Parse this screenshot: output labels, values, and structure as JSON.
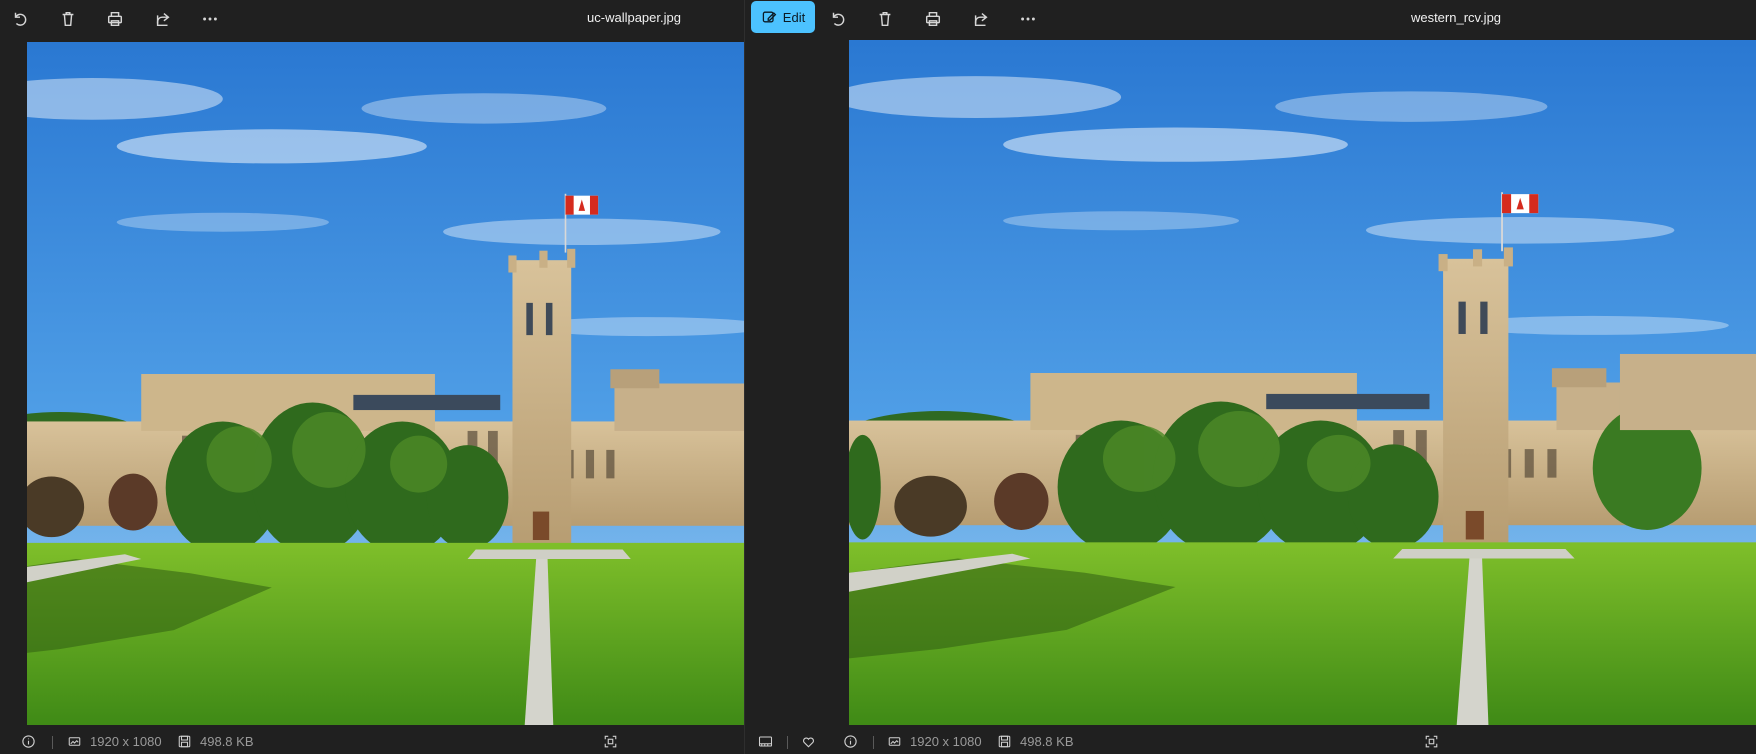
{
  "left_viewer": {
    "title": "uc-wallpaper.jpg",
    "toolbar": {
      "icons": [
        "rotate-icon",
        "delete-icon",
        "print-icon",
        "share-icon",
        "more-icon"
      ]
    },
    "status": {
      "dimensions": "1920 x 1080",
      "file_size": "498.8 KB"
    }
  },
  "right_viewer": {
    "title": "western_rcv.jpg",
    "toolbar": {
      "edit_label": "Edit",
      "icons": [
        "edit-icon",
        "rotate-icon",
        "delete-icon",
        "print-icon",
        "share-icon",
        "more-icon"
      ]
    },
    "status": {
      "dimensions": "1920 x 1080",
      "file_size": "498.8 KB"
    }
  },
  "colors": {
    "background": "#202020",
    "accent": "#4cc2ff",
    "text": "#f0f0f0",
    "muted_text": "#9a9a9a"
  }
}
